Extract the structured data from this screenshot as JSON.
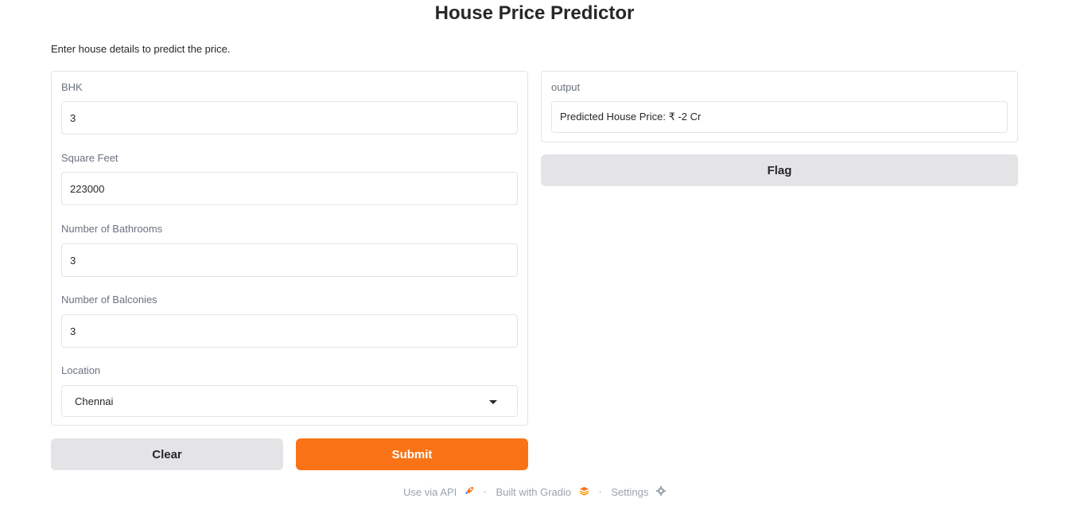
{
  "page": {
    "title": "House Price Predictor",
    "description": "Enter house details to predict the price."
  },
  "inputs": {
    "bhk": {
      "label": "BHK",
      "value": "3"
    },
    "square_feet": {
      "label": "Square Feet",
      "value": "223000"
    },
    "bathrooms": {
      "label": "Number of Bathrooms",
      "value": "3"
    },
    "balconies": {
      "label": "Number of Balconies",
      "value": "3"
    },
    "location": {
      "label": "Location",
      "value": "Chennai"
    }
  },
  "output": {
    "label": "output",
    "value": "Predicted House Price: ₹ -2 Cr"
  },
  "buttons": {
    "flag": "Flag",
    "clear": "Clear",
    "submit": "Submit"
  },
  "footer": {
    "api": "Use via API",
    "built": "Built with Gradio",
    "settings": "Settings",
    "separator": "·"
  },
  "colors": {
    "primary": "#f97316",
    "secondary": "#e4e4e7"
  }
}
